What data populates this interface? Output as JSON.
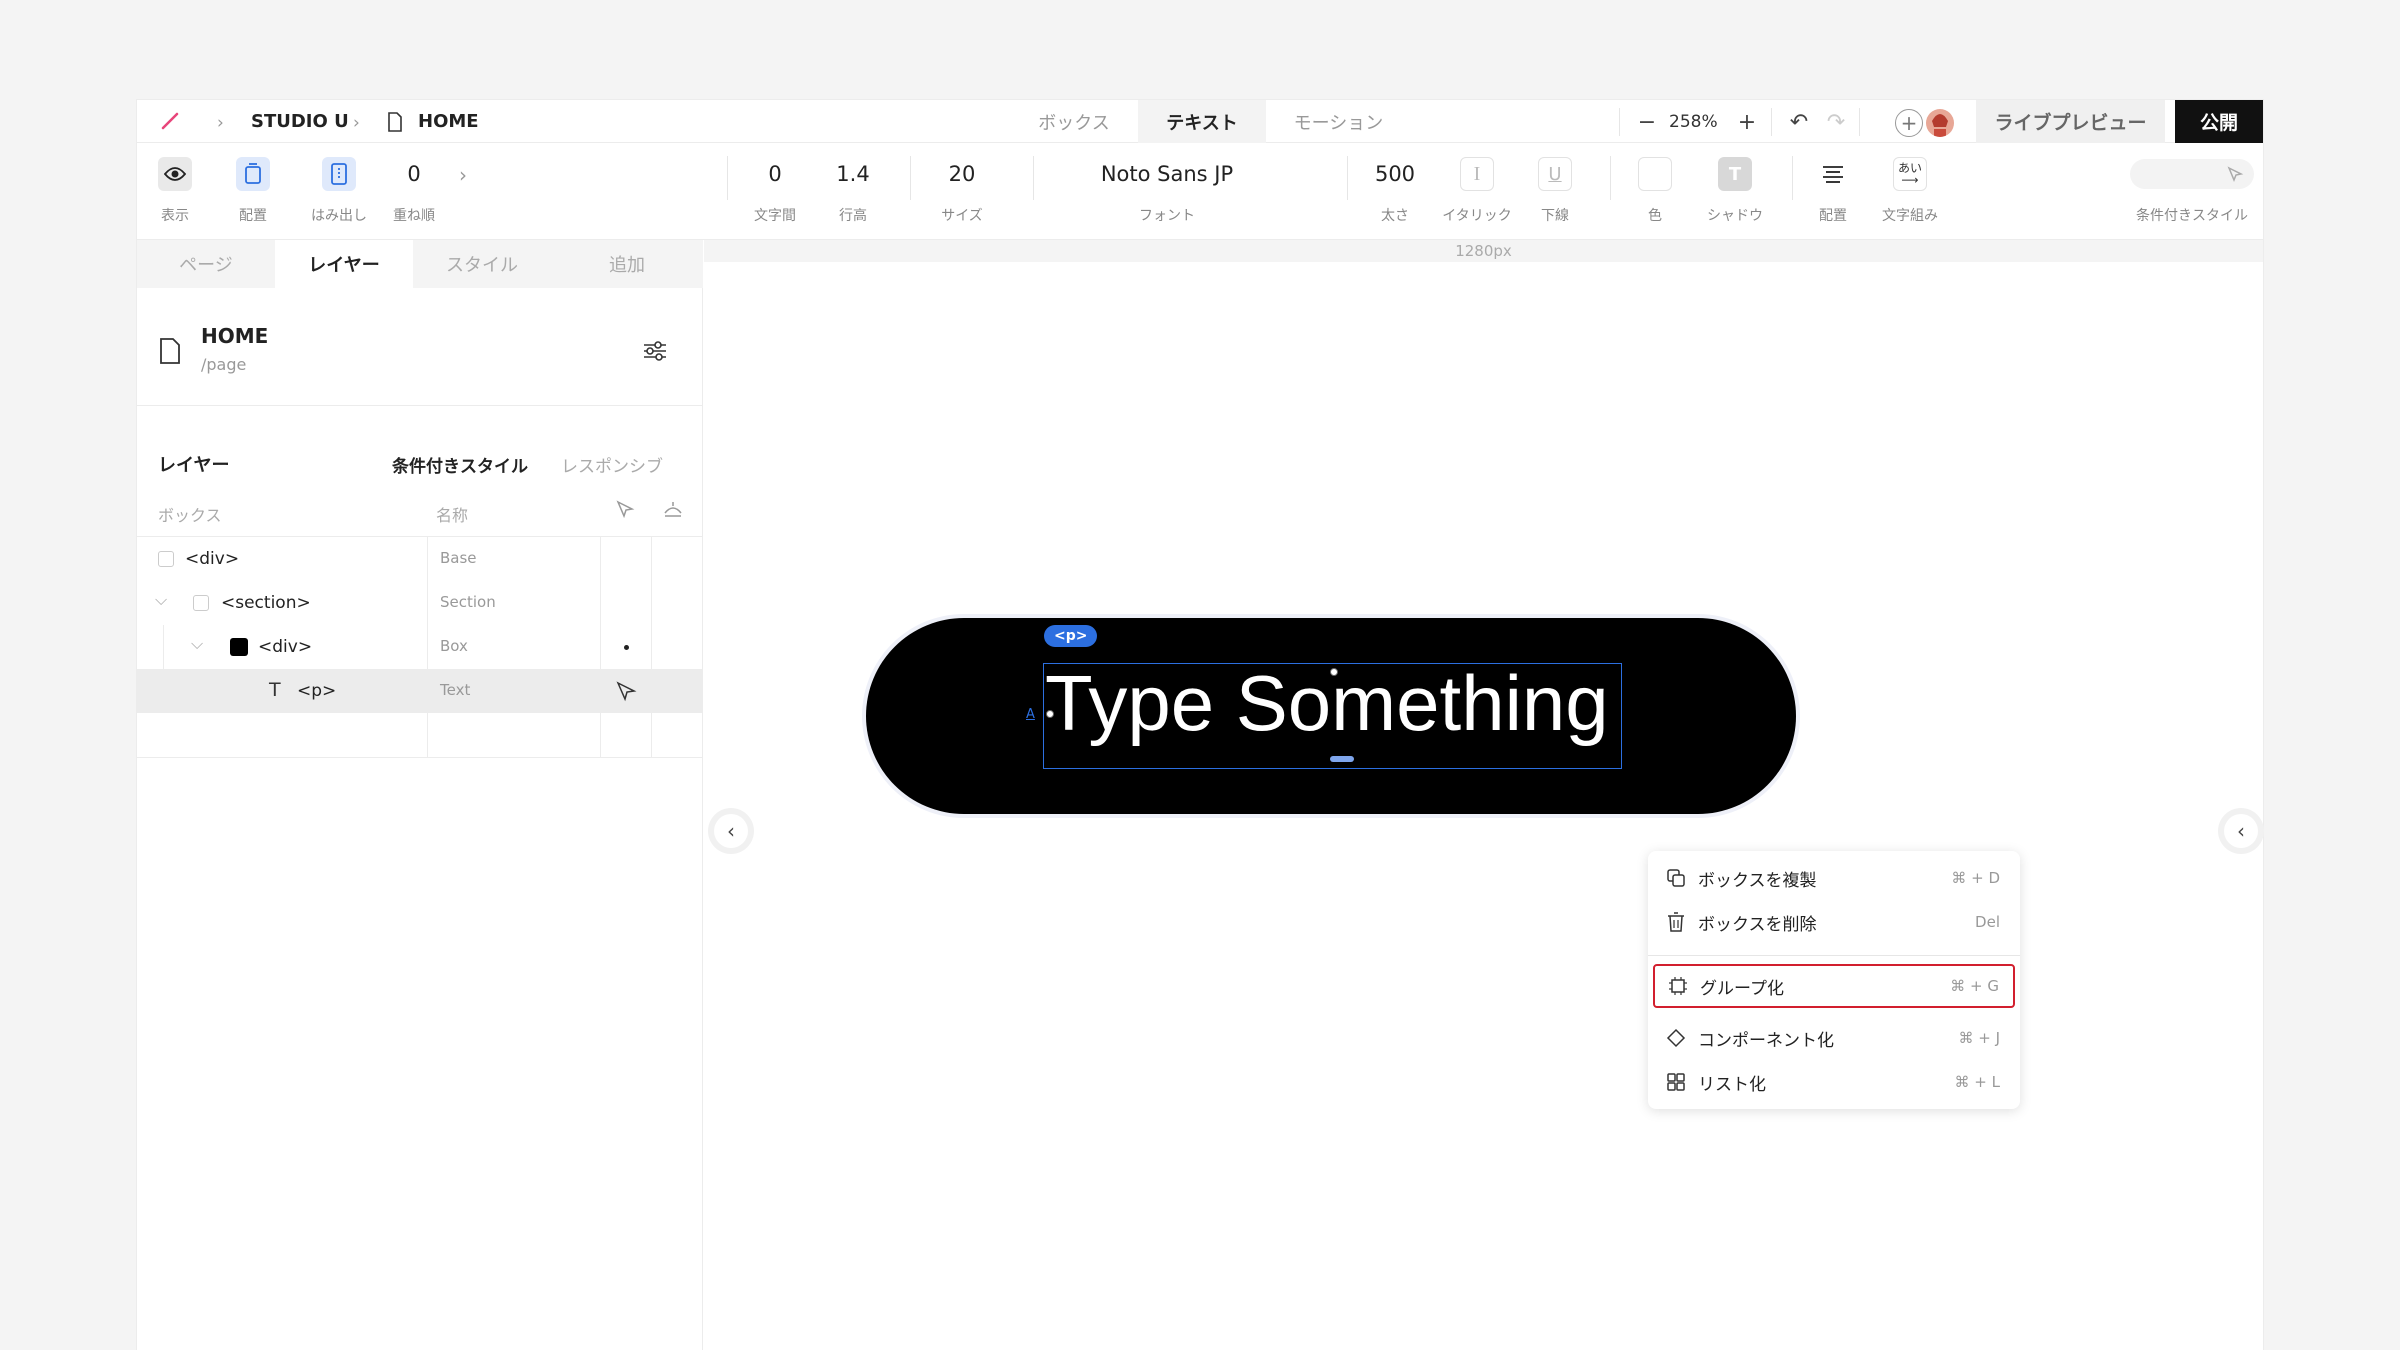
{
  "header": {
    "breadcrumb": [
      "STUDIO U",
      "HOME"
    ],
    "tabs": [
      {
        "label": "ボックス",
        "active": false
      },
      {
        "label": "テキスト",
        "active": true
      },
      {
        "label": "モーション",
        "active": false
      }
    ],
    "zoom": "258%",
    "preview_label": "ライブプレビュー",
    "publish_label": "公開"
  },
  "toolbar": {
    "left_tools": [
      {
        "icon": "eye-icon",
        "label": "表示"
      },
      {
        "icon": "align-icon",
        "label": "配置"
      },
      {
        "icon": "overflow-icon",
        "label": "はみ出し"
      }
    ],
    "order_value": "0",
    "order_label": "重ね順",
    "text_tools": [
      {
        "value": "0",
        "label": "文字間"
      },
      {
        "value": "1.4",
        "label": "行高"
      },
      {
        "value": "20",
        "label": "サイズ"
      },
      {
        "value": "Noto Sans JP",
        "label": "フォント"
      },
      {
        "value": "500",
        "label": "太さ"
      }
    ],
    "italic_label": "イタリック",
    "underline_label": "下線",
    "color_label": "色",
    "shadow_label": "シャドウ",
    "align_label": "配置",
    "typeset_label": "文字組み",
    "conditional_label": "条件付きスタイル"
  },
  "left_panel": {
    "tabs": [
      {
        "label": "ページ",
        "active": false
      },
      {
        "label": "レイヤー",
        "active": true
      },
      {
        "label": "スタイル",
        "active": false
      },
      {
        "label": "追加",
        "active": false
      }
    ],
    "page": {
      "title": "HOME",
      "path": "/page"
    },
    "layers_title": "レイヤー",
    "conditional_style": "条件付きスタイル",
    "responsive": "レスポンシブ",
    "col_box": "ボックス",
    "col_name": "名称",
    "rows": [
      {
        "tag": "<div>",
        "name": "Base"
      },
      {
        "tag": "<section>",
        "name": "Section"
      },
      {
        "tag": "<div>",
        "name": "Box"
      },
      {
        "tag": "<p>",
        "name": "Text"
      }
    ]
  },
  "canvas": {
    "width_label": "1280px",
    "element_tag": "<p>",
    "text": "Type Something"
  },
  "context_menu": {
    "items": [
      {
        "label": "ボックスを複製",
        "shortcut": "⌘ + D",
        "icon": "duplicate-icon"
      },
      {
        "label": "ボックスを削除",
        "shortcut": "Del",
        "icon": "trash-icon"
      },
      {
        "label": "グループ化",
        "shortcut": "⌘ + G",
        "icon": "group-icon",
        "highlighted": true
      },
      {
        "label": "コンポーネント化",
        "shortcut": "⌘ + J",
        "icon": "component-icon"
      },
      {
        "label": "リスト化",
        "shortcut": "⌘ + L",
        "icon": "list-icon"
      }
    ]
  },
  "colors": {
    "accent": "#2c6fe0",
    "highlight": "#d21f2e",
    "pill": "#000000"
  }
}
